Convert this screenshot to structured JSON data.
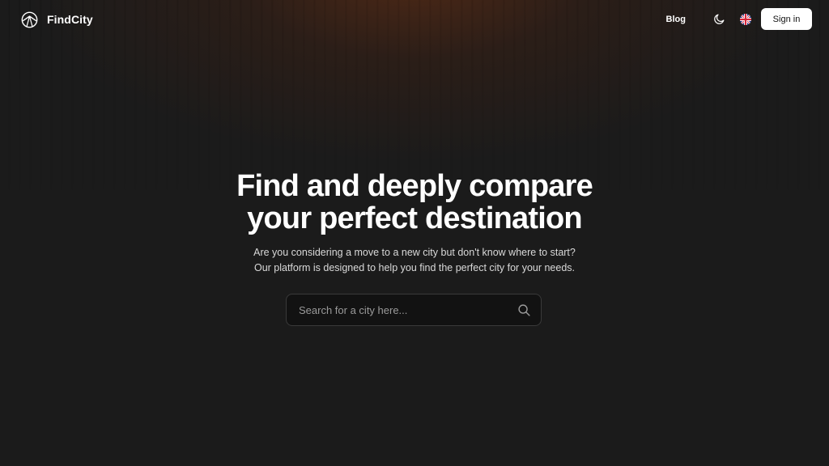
{
  "brand": {
    "name": "FindCity",
    "logo_icon": "mountain-circle-logo-icon"
  },
  "nav": {
    "blog_label": "Blog",
    "theme_icon": "moon-icon",
    "language_icon": "uk-flag-icon",
    "signin_label": "Sign in"
  },
  "hero": {
    "title_line1": "Find and deeply compare",
    "title_line2": "your perfect destination",
    "subtitle_line1": "Are you considering a move to a new city but don't know where to start?",
    "subtitle_line2": "Our platform is designed to help you find the perfect city for your needs."
  },
  "search": {
    "placeholder": "Search for a city here...",
    "value": "",
    "icon": "search-icon"
  },
  "colors": {
    "background": "#1b1b1b",
    "glow": "#78341206",
    "button_bg": "#ffffff",
    "search_bg": "#121212"
  }
}
